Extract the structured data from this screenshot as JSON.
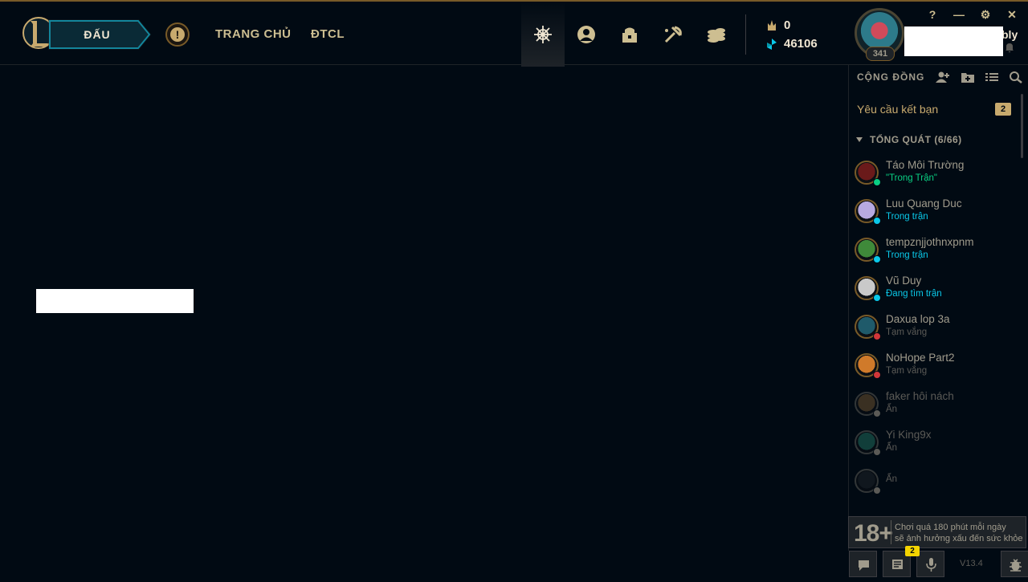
{
  "header": {
    "play_label": "ĐẤU",
    "alert_symbol": "!",
    "nav": [
      "TRANG CHỦ",
      "ĐTCL"
    ],
    "icons": [
      "clash-icon",
      "profile-icon",
      "collection-icon",
      "loot-icon",
      "store-icon"
    ],
    "currency": {
      "rp": "0",
      "be": "46106"
    },
    "profile": {
      "level": "341",
      "name_tail": "bly"
    },
    "window_controls": [
      "?",
      "—",
      "⚙",
      "✕"
    ]
  },
  "social": {
    "title": "CỘNG ĐỒNG",
    "friend_requests_label": "Yêu cầu kết bạn",
    "friend_requests_count": "2",
    "group_label": "TỔNG QUÁT (6/66)",
    "friends": [
      {
        "name": "Táo Môi Trường",
        "status": "\"Trong Trận\"",
        "status_color": "#0acf83",
        "dot": "#0acf83",
        "avatar": "#6a1a1a",
        "dim": false
      },
      {
        "name": "Luu Quang Duc",
        "status": "Trong trận",
        "status_color": "#0ac8e9",
        "dot": "#0ac8e9",
        "avatar": "#b7a9e0",
        "dim": false
      },
      {
        "name": "tempznjjothnxpnm",
        "status": "Trong trận",
        "status_color": "#0ac8e9",
        "dot": "#0ac8e9",
        "avatar": "#3f8a3a",
        "dim": false
      },
      {
        "name": "Vũ Duy",
        "status": "Đang tìm trận",
        "status_color": "#0ac8e9",
        "dot": "#0ac8e9",
        "avatar": "#c9c9c9",
        "dim": false
      },
      {
        "name": "Daxua lop 3a",
        "status": "Tạm vắng",
        "status_color": "#5b5a56",
        "dot": "#d13639",
        "avatar": "#1f5a6a",
        "dim": false
      },
      {
        "name": "NoHope Part2",
        "status": "Tạm vắng",
        "status_color": "#5b5a56",
        "dot": "#d13639",
        "avatar": "#d07a2a",
        "dim": false
      },
      {
        "name": "faker hôi nách",
        "status": "Ẩn",
        "status_color": "#5b5a56",
        "dot": "#5b5a56",
        "avatar": "#6a5030",
        "dim": true
      },
      {
        "name": "Yi King9x",
        "status": "Ẩn",
        "status_color": "#5b5a56",
        "dot": "#5b5a56",
        "avatar": "#1f6a5a",
        "dim": true
      },
      {
        "name": "",
        "status": "Ẩn",
        "status_color": "#5b5a56",
        "dot": "#5b5a56",
        "avatar": "#1e2328",
        "dim": true
      }
    ]
  },
  "age_notice": {
    "rating": "18+",
    "line1": "Chơi quá 180 phút mỗi ngày",
    "line2": "sẽ ảnh hưởng xấu đến sức khỏe"
  },
  "bottom": {
    "missions_count": "2",
    "version": "V13.4"
  },
  "colors": {
    "background": "#010a13",
    "gold": "#c8aa6e",
    "gold_dark": "#785a28",
    "text": "#a09b8c",
    "online": "#0acf83",
    "in_game": "#0ac8e9",
    "away": "#d13639"
  }
}
